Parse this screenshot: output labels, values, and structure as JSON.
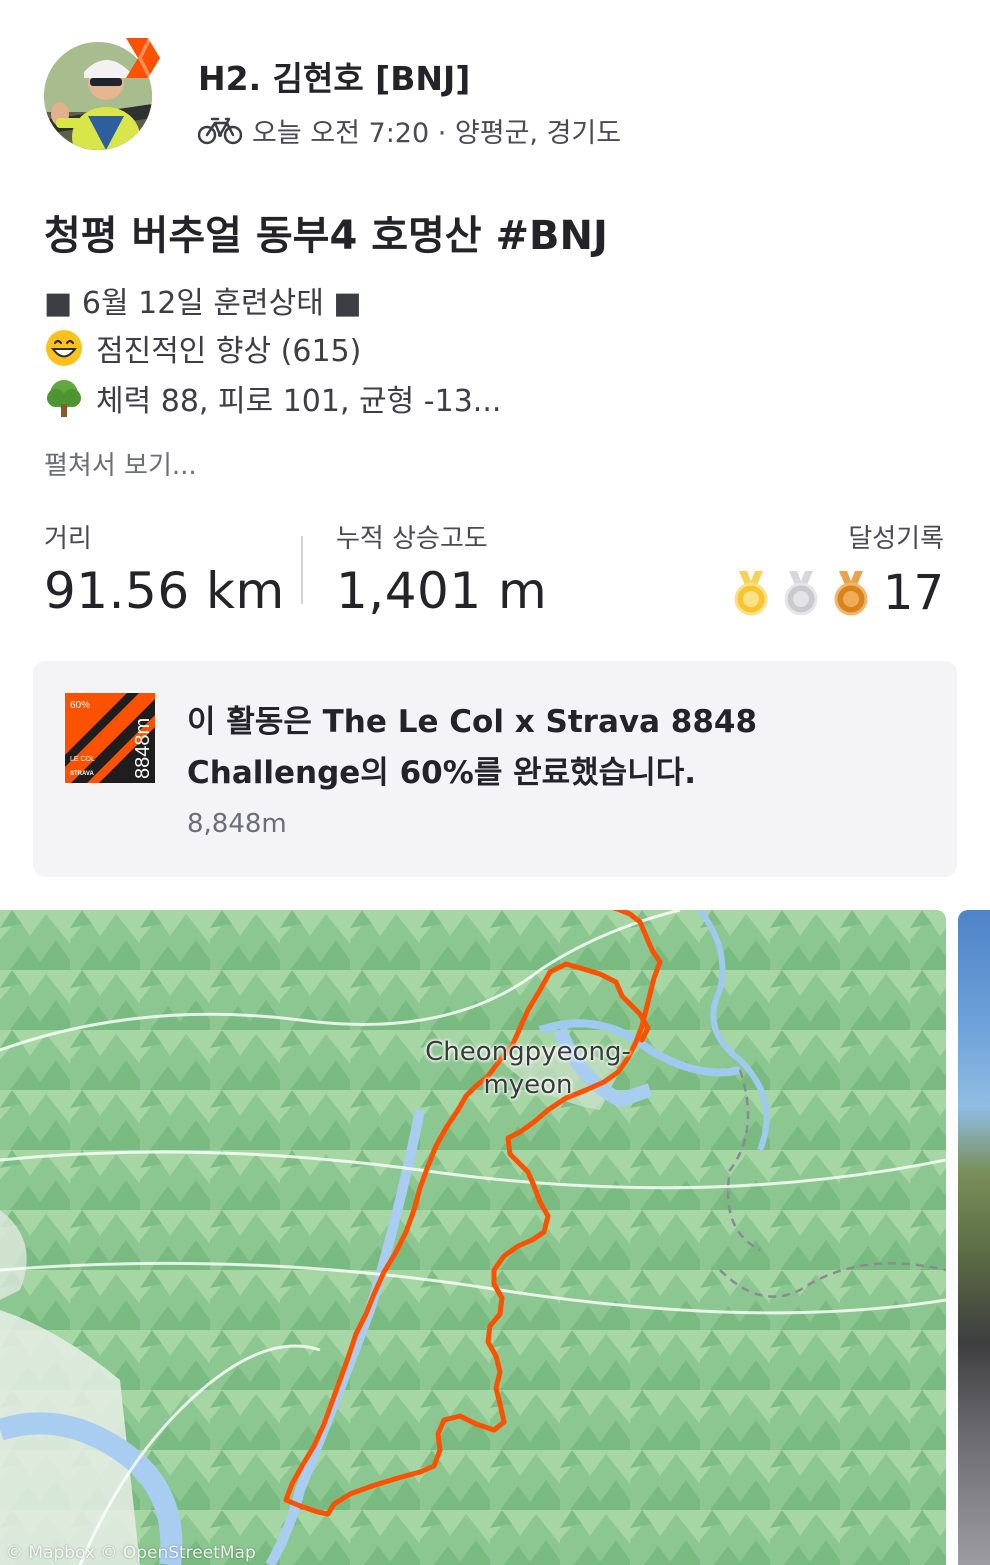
{
  "header": {
    "athlete_name": "H2. 김현호 [BNJ]",
    "activity_icon": "bike-icon",
    "meta": "오늘 오전 7:20 · 양평군, 경기도"
  },
  "activity": {
    "title": "청평 버추얼 동부4 호명산 #BNJ",
    "description": {
      "line1": "■ 6월 12일 훈련상태 ■",
      "line2_icon": "grinning-face-emoji",
      "line2": "점진적인 향상 (615)",
      "line3_icon": "tree-emoji",
      "line3": "체력 88, 피로 101, 균형 -13..."
    },
    "expand_label": "펼쳐서 보기..."
  },
  "stats": {
    "distance_label": "거리",
    "distance_value": "91.56 km",
    "elevation_label": "누적 상승고도",
    "elevation_value": "1,401 m",
    "achievements_label": "달성기록",
    "medals": [
      "gold-medal-icon",
      "silver-medal-icon",
      "bronze-medal-icon"
    ],
    "achievements_count": "17"
  },
  "challenge": {
    "badge_icon": "challenge-badge-icon",
    "badge_text": [
      "60%",
      "LE COL",
      "STRAVA",
      "8848m"
    ],
    "text": "이 활동은 The Le Col x Strava 8848 Challenge의 60%를 완료했습니다.",
    "subtext": "8,848m"
  },
  "map": {
    "place_label_1": "Cheongpyeong-",
    "place_label_2": "myeon",
    "attribution": "© Mapbox © OpenStreetMap",
    "route_color": "#fc5200"
  },
  "colors": {
    "brand": "#fc5200",
    "text_primary": "#242428",
    "text_secondary": "#6d6d78",
    "card_bg": "#f4f4f6",
    "map_green": "#9fd0a0"
  }
}
